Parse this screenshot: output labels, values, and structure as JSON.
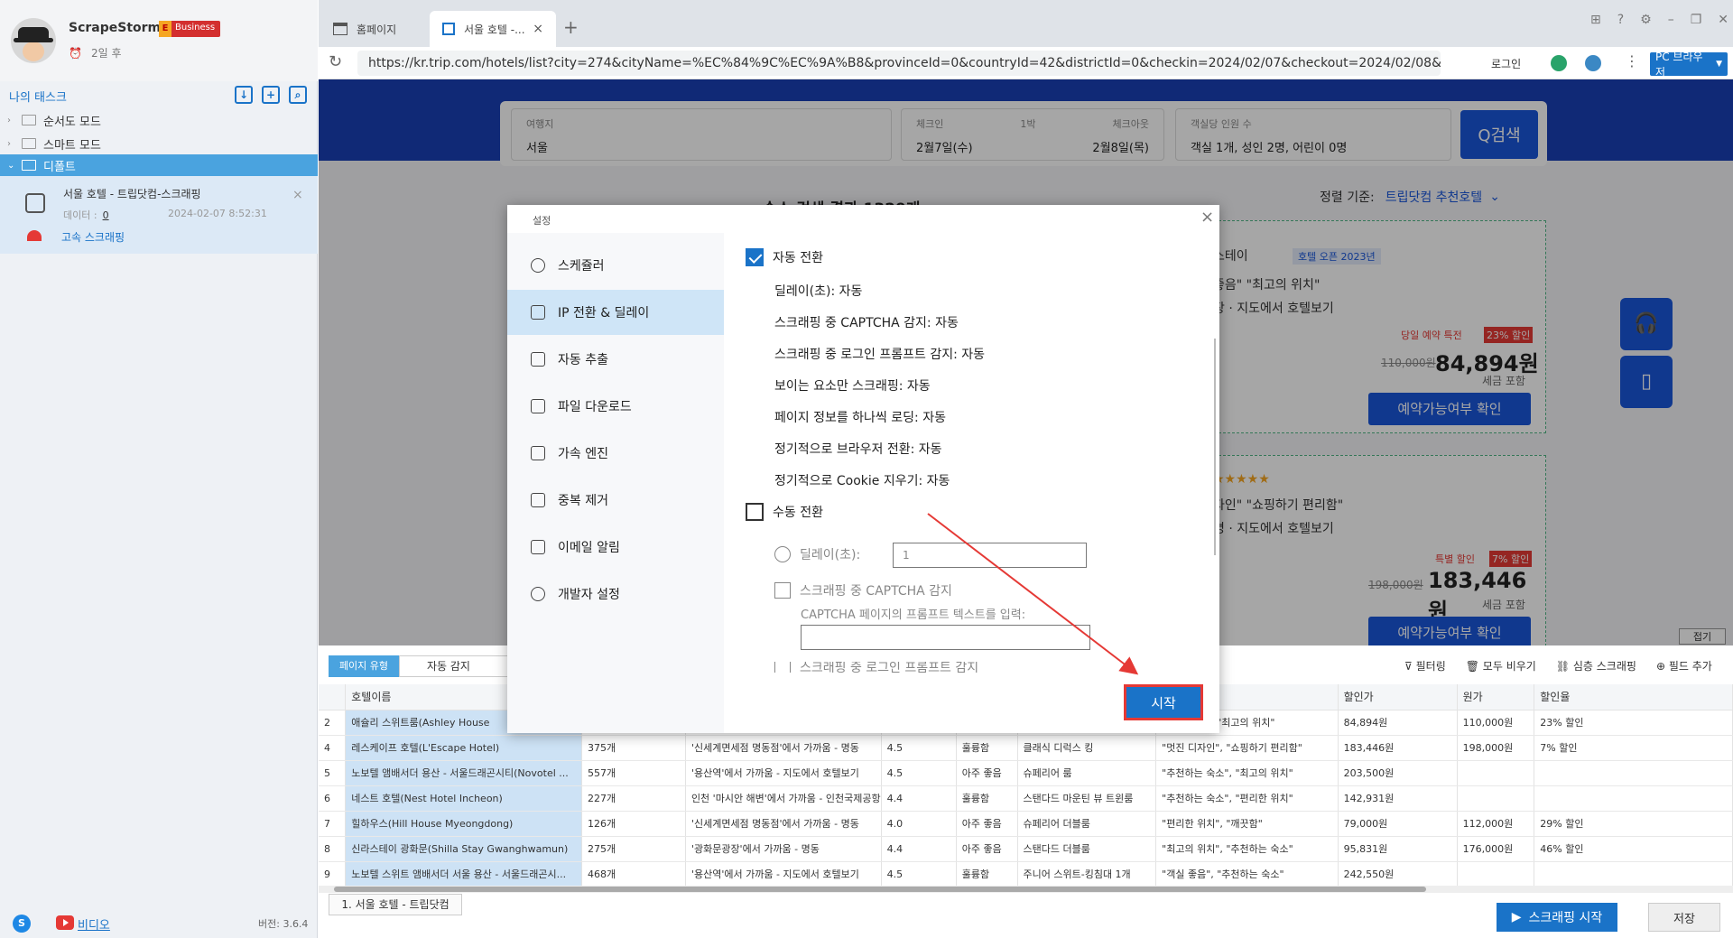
{
  "sidebar": {
    "app_name": "ScrapeStorm",
    "edition": "Business",
    "expire": "2일 후",
    "my_tasks": "나의 태스크",
    "tree": [
      "순서도 모드",
      "스마트 모드",
      "디폴트"
    ],
    "task": {
      "title": "서울 호텔 - 트립닷컴-스크래핑",
      "data_label": "데이터 :",
      "data_count": "0",
      "date": "2024-02-07 8:52:31",
      "speed": "고속 스크래핑"
    },
    "video": "비디오",
    "version": "버전: 3.6.4"
  },
  "browser": {
    "tabs": [
      "홈페이지",
      "서울 호텔 -..."
    ],
    "url": "https://kr.trip.com/hotels/list?city=274&cityName=%EC%84%9C%EC%9A%B8&provinceId=0&countryId=42&districtId=0&checkin=2024/02/07&checkout=2024/02/08&...",
    "login": "로그인",
    "pc_browser": "PC 브라우저"
  },
  "web": {
    "destination_label": "여행지",
    "destination": "서울",
    "checkin_label": "체크인",
    "checkin": "2월7일(수)",
    "nights": "1박",
    "checkout_label": "체크아웃",
    "checkout": "2월8일(목)",
    "guests_label": "객실당 인원 수",
    "guests": "객실 1개, 성인 2명, 어린이 0명",
    "search": "Q검색",
    "result_header": "숙소 검색 결과 1329개",
    "sort_label": "정렬 기준:",
    "sort_value": "트립닷컴 추천호텔",
    "card1": {
      "name_tail": "스테이",
      "open": "호텔 오픈 2023년",
      "quote": "좋음\"  \"최고의 위치\"",
      "map": "장 · 지도에서 호텔보기",
      "deal": "당일 예약 특전",
      "discount": "23% 할인",
      "old_price": "110,000원",
      "new_price": "84,894원",
      "tax": "세금 포함",
      "button": "예약가능여부 확인"
    },
    "card2": {
      "quote": "자인\"  \"쇼핑하기 편리함\"",
      "map": "명 · 지도에서 호텔보기",
      "deal": "특별 할인",
      "discount": "7% 할인",
      "old_price": "198,000원",
      "new_price": "183,446원",
      "tax": "세금 포함",
      "button": "예약가능여부 확인"
    },
    "collapse": "접기"
  },
  "data_panel": {
    "page_type": "페이지 유형",
    "auto_detect": "자동 감지",
    "tools": [
      "필터링",
      "모두 비우기",
      "심층 스크래핑",
      "필드 추가"
    ],
    "columns": [
      "",
      "호텔이름",
      "",
      "",
      "",
      "",
      "",
      "리뷰",
      "할인가",
      "원가",
      "할인율"
    ],
    "rows": [
      [
        "2",
        "애슐리 스위트룸(Ashley House",
        "",
        "",
        "",
        "",
        "",
        "\"객실 좋음\", \"최고의 위치\"",
        "84,894원",
        "110,000원",
        "23% 할인"
      ],
      [
        "4",
        "레스케이프 호텔(L'Escape Hotel)",
        "375개",
        "'신세계면세점 명동점'에서 가까움 - 명동",
        "4.5",
        "훌륭함",
        "클래식 디럭스 킹",
        "\"멋진 디자인\", \"쇼핑하기 편리함\"",
        "183,446원",
        "198,000원",
        "7% 할인"
      ],
      [
        "5",
        "노보텔 앰배서더 용산 - 서울드래곤시티(Novotel ...",
        "557개",
        "'용산역'에서 가까움 - 지도에서 호텔보기",
        "4.5",
        "아주 좋음",
        "슈페리어 룸",
        "\"추천하는 숙소\", \"최고의 위치\"",
        "203,500원",
        "",
        ""
      ],
      [
        "6",
        "네스트 호텔(Nest Hotel Incheon)",
        "227개",
        "인천 '마시안 해변'에서 가까움 - 인천국제공항",
        "4.4",
        "훌륭함",
        "스탠다드 마운틴 뷰 트윈룸",
        "\"추천하는 숙소\", \"편리한 위치\"",
        "142,931원",
        "",
        ""
      ],
      [
        "7",
        "힐하우스(Hill House Myeongdong)",
        "126개",
        "'신세계면세점 명동점'에서 가까움 - 명동",
        "4.0",
        "아주 좋음",
        "슈페리어 더블룸",
        "\"편리한 위치\", \"깨끗함\"",
        "79,000원",
        "112,000원",
        "29% 할인"
      ],
      [
        "8",
        "신라스테이 광화문(Shilla Stay Gwanghwamun)",
        "275개",
        "'광화문광장'에서 가까움 - 명동",
        "4.4",
        "아주 좋음",
        "스탠다드 더블룸",
        "\"최고의 위치\", \"추천하는 숙소\"",
        "95,831원",
        "176,000원",
        "46% 할인"
      ],
      [
        "9",
        "노보텔 스위트 앰배서더 서울 용산 - 서울드래곤시...",
        "468개",
        "'용산역'에서 가까움 - 지도에서 호텔보기",
        "4.5",
        "훌륭함",
        "주니어 스위트-킹침대 1개",
        "\"객실 좋음\", \"추천하는 숙소\"",
        "242,550원",
        "",
        ""
      ]
    ],
    "sheet_tab": "1. 서울 호텔 - 트립닷컴",
    "start": "스크래핑 시작",
    "save": "저장"
  },
  "modal": {
    "title": "설정",
    "nav": [
      "스케쥴러",
      "IP 전환 & 딜레이",
      "자동 추출",
      "파일 다운로드",
      "가속 엔진",
      "중복 제거",
      "이메일 알림",
      "개발자 설정"
    ],
    "auto_switch": "자동 전환",
    "auto_opts": [
      "딜레이(초):  자동",
      "스크래핑 중 CAPTCHA 감지:  자동",
      "스크래핑 중 로그인 프롬프트 감지:  자동",
      "보이는 요소만 스크래핑:  자동",
      "페이지 정보를 하나씩 로딩:  자동",
      "정기적으로 브라우저 전환:  자동",
      "정기적으로 Cookie 지우기:  자동"
    ],
    "manual_switch": "수동 전환",
    "delay_label": "딜레이(초):",
    "delay_value": "1",
    "captcha_label": "스크래핑 중 CAPTCHA 감지",
    "captcha_prompt": "CAPTCHA 페이지의 프롬프트 텍스트를 입력:",
    "login_detect": "스크래핑 중 로그인 프롬프트 감지",
    "start": "시작"
  },
  "colors": {
    "accent": "#1a73c8",
    "highlight_border": "#e53935",
    "trip_blue": "#1a56db"
  }
}
